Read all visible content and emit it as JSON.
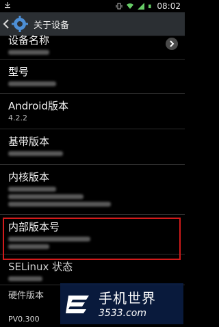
{
  "statusbar": {
    "time": "08:02"
  },
  "actionbar": {
    "title": "关于设备"
  },
  "items": [
    {
      "title": "设备名称"
    },
    {
      "title": "型号"
    },
    {
      "title": "Android版本",
      "value": "4.2.2"
    },
    {
      "title": "基带版本"
    },
    {
      "title": "内核版本"
    },
    {
      "title": "内部版本号"
    },
    {
      "title": "SELinux 状态"
    },
    {
      "title": "硬件版本",
      "value": "PV0.300"
    }
  ],
  "watermark": {
    "brand": "手机世界",
    "site": "3533.com"
  }
}
